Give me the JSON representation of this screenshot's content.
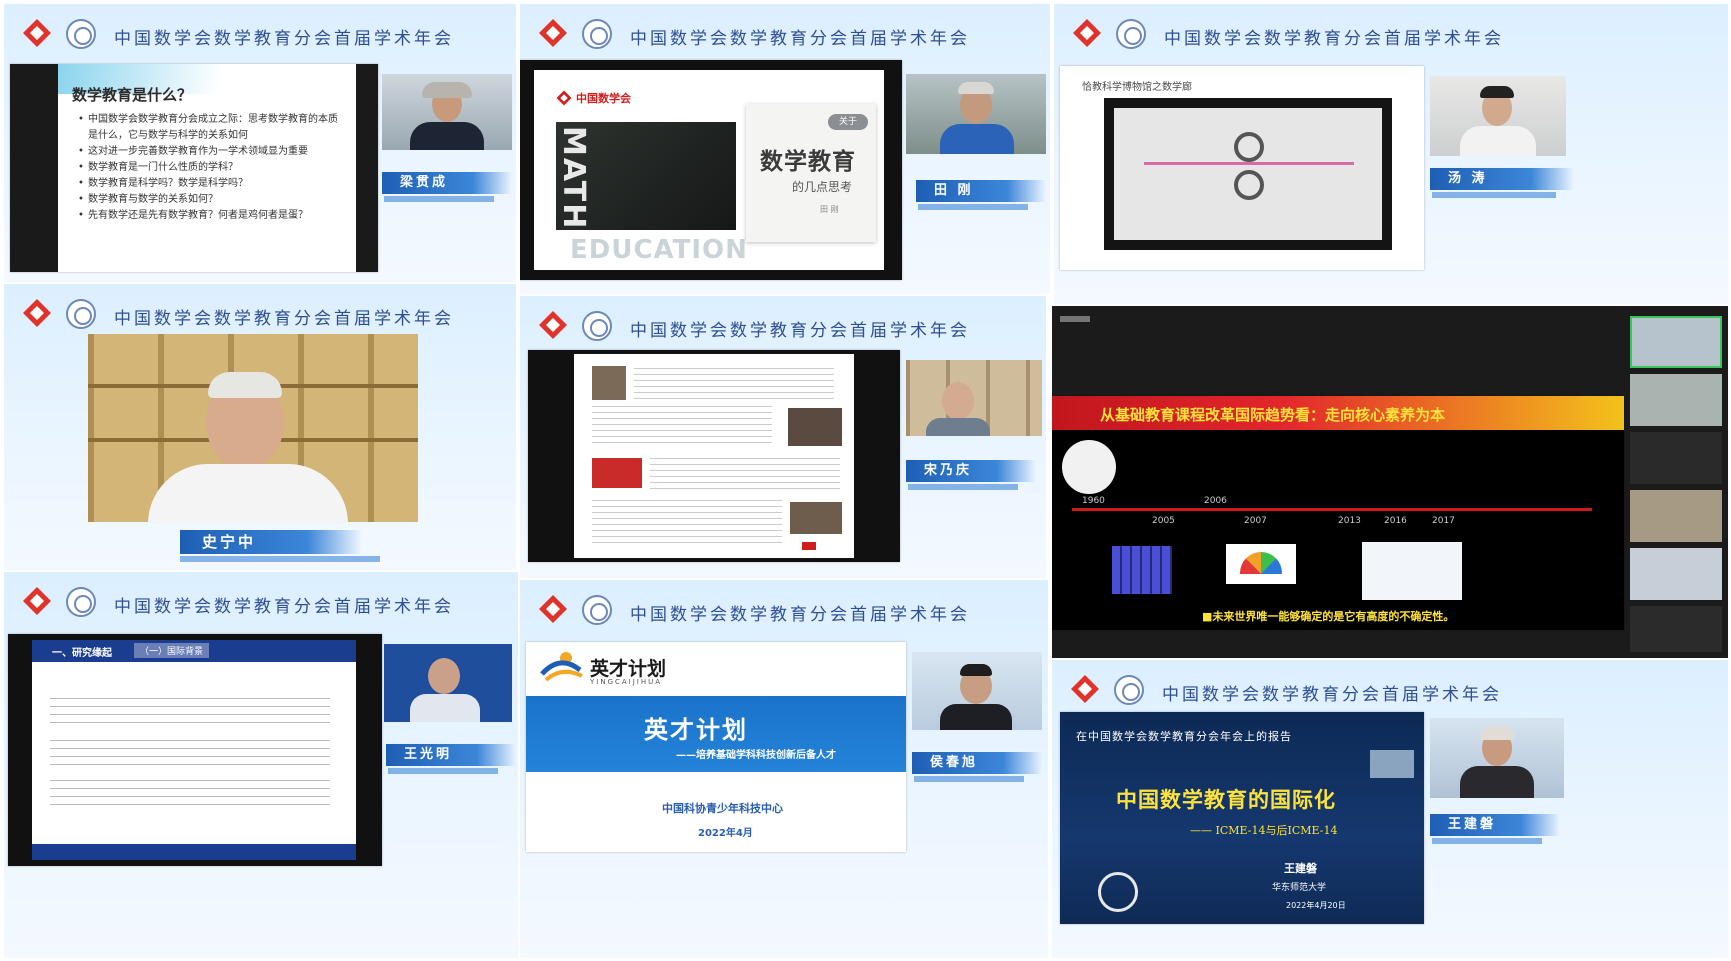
{
  "conference_title": "中国数学会数学教育分会首届学术年会",
  "colors": {
    "header_text": "#2f4f93",
    "nametag_blue": "#1e5fb4",
    "brand_red": "#e0332b",
    "slide_red": "#d01e1e"
  },
  "tiles": {
    "t1": {
      "slide_title": "数学教育是什么？",
      "bullets": [
        "中国数学会数学教育分会成立之际：思考数学教育的本质是什么，它与数学与科学的关系如何",
        "这对进一步完善数学教育作为一学术领域显为重要",
        "数学教育是一门什么性质的学科？",
        "数学教育是科学吗？数学是科学吗？",
        "数学教育与数学的关系如何？",
        "先有数学还是先有数学教育？何者是鸡何者是蛋？"
      ],
      "speaker": "梁贯成"
    },
    "t2": {
      "brand": "中国数学会",
      "tag": "关于",
      "title": "数学教育",
      "subtitle": "的几点思考",
      "author": "田 刚",
      "bg_text_1": "MATH",
      "bg_text_2": "EDUCATION",
      "speaker": "田 刚"
    },
    "t3": {
      "slide_caption": "恰教科学博物馆之数学廊",
      "speaker": "汤 涛"
    },
    "t4": {
      "speaker": "史宁中"
    },
    "t5": {
      "speaker": "宋乃庆"
    },
    "t6": {
      "title": "从基础教育课程改革国际趋势看：走向核心素养为本",
      "years_top": [
        "1960",
        "2006"
      ],
      "years_bottom": [
        "2005",
        "2007",
        "2013",
        "2016",
        "2017"
      ],
      "footer": "■未来世界唯一能够确定的是它有高度的不确定性。"
    },
    "t7": {
      "tab1": "一、研究缘起",
      "tab2": "（一）国际背景",
      "speaker": "王光明"
    },
    "t8": {
      "logo_text": "英才计划",
      "logo_sub": "YINGCAIJIHUA",
      "title": "英才计划",
      "subtitle": "——培养基础学科科技创新后备人才",
      "org": "中国科协青少年科技中心",
      "date": "2022年4月",
      "speaker": "侯春旭"
    },
    "t9": {
      "top_line": "在中国数学会数学教育分会年会上的报告",
      "title": "中国数学教育的国际化",
      "subtitle": "—— ICME-14与后ICME-14",
      "author": "王建磐",
      "affiliation": "华东师范大学",
      "date": "2022年4月20日",
      "speaker": "王建磐"
    }
  }
}
